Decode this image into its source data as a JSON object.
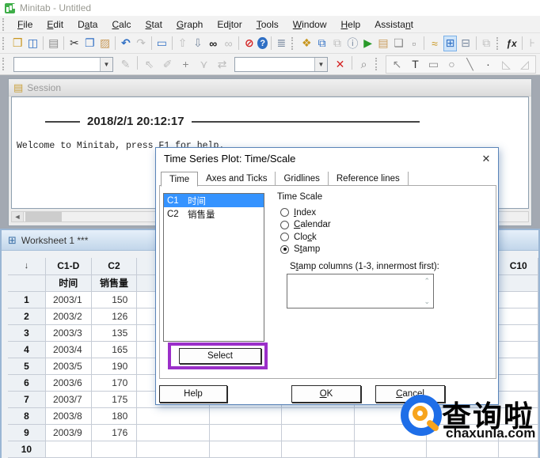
{
  "window": {
    "title": "Minitab - Untitled"
  },
  "menu": {
    "items": [
      {
        "label": "File",
        "accel": 0
      },
      {
        "label": "Edit",
        "accel": 0
      },
      {
        "label": "Data",
        "accel": 1
      },
      {
        "label": "Calc",
        "accel": 0
      },
      {
        "label": "Stat",
        "accel": 0
      },
      {
        "label": "Graph",
        "accel": 0
      },
      {
        "label": "Editor",
        "accel": 2
      },
      {
        "label": "Tools",
        "accel": 0
      },
      {
        "label": "Window",
        "accel": 0
      },
      {
        "label": "Help",
        "accel": 0
      },
      {
        "label": "Assistant",
        "accel": 7
      }
    ]
  },
  "toolbar_main": {
    "icons": [
      {
        "t": "g"
      },
      {
        "t": "i",
        "name": "open-icon",
        "g": "❒",
        "c": "gold"
      },
      {
        "t": "i",
        "name": "save-icon",
        "g": "◫",
        "c": "blue"
      },
      {
        "t": "s"
      },
      {
        "t": "i",
        "name": "print-icon",
        "g": "▤",
        "c": "dim"
      },
      {
        "t": "s"
      },
      {
        "t": "i",
        "name": "cut-icon",
        "g": "✂",
        "c": "dark"
      },
      {
        "t": "i",
        "name": "copy-icon",
        "g": "❐",
        "c": "blue"
      },
      {
        "t": "i",
        "name": "paste-icon",
        "g": "▨",
        "c": "tan"
      },
      {
        "t": "s"
      },
      {
        "t": "i",
        "name": "undo-icon",
        "g": "↶",
        "c": "blueb"
      },
      {
        "t": "i",
        "name": "redo-icon",
        "g": "↷",
        "c": "dis"
      },
      {
        "t": "s"
      },
      {
        "t": "i",
        "name": "edit-last-dialog-icon",
        "g": "▭",
        "c": "blue"
      },
      {
        "t": "s"
      },
      {
        "t": "i",
        "name": "previous-command-icon",
        "g": "⇧",
        "c": "dis"
      },
      {
        "t": "i",
        "name": "next-command-icon",
        "g": "⇩",
        "c": "steel"
      },
      {
        "t": "i",
        "name": "find-icon",
        "g": "∞",
        "c": "darkb"
      },
      {
        "t": "i",
        "name": "find-next-icon",
        "g": "∞",
        "c": "dis"
      },
      {
        "t": "s"
      },
      {
        "t": "i",
        "name": "cancel-icon",
        "g": "⊘",
        "c": "redb"
      },
      {
        "t": "i",
        "name": "help-icon",
        "g": "?",
        "c": "badge"
      },
      {
        "t": "s"
      },
      {
        "t": "i",
        "name": "show-session-icon",
        "g": "≣",
        "c": "steel"
      },
      {
        "t": "g"
      },
      {
        "t": "i",
        "name": "session-window-icon",
        "g": "❖",
        "c": "gold"
      },
      {
        "t": "i",
        "name": "worksheets-icon",
        "g": "⧉",
        "c": "blue"
      },
      {
        "t": "i",
        "name": "copy-worksheet-icon",
        "g": "⧉",
        "c": "dis"
      },
      {
        "t": "i",
        "name": "info-icon",
        "g": "ⓘ",
        "c": "steel"
      },
      {
        "t": "i",
        "name": "run-icon",
        "g": "▶",
        "c": "green"
      },
      {
        "t": "i",
        "name": "notepad-icon",
        "g": "▤",
        "c": "tan"
      },
      {
        "t": "i",
        "name": "page-up-icon",
        "g": "❏",
        "c": "dim"
      },
      {
        "t": "i",
        "name": "selection-frame-icon",
        "g": "▫",
        "c": "dim"
      },
      {
        "t": "s"
      },
      {
        "t": "i",
        "name": "graph-window-icon",
        "g": "≈",
        "c": "gold"
      },
      {
        "t": "i",
        "name": "worksheet-window-icon",
        "g": "⊞",
        "c": "active"
      },
      {
        "t": "i",
        "name": "split-view-icon",
        "g": "⊟",
        "c": "steel"
      },
      {
        "t": "s"
      },
      {
        "t": "i",
        "name": "cascade-windows-icon",
        "g": "⧉",
        "c": "dis"
      },
      {
        "t": "g"
      },
      {
        "t": "i",
        "name": "function-icon",
        "g": "ƒx",
        "c": "darki"
      },
      {
        "t": "s"
      },
      {
        "t": "i",
        "name": "project-tree-icon",
        "g": "⊦",
        "c": "dis"
      }
    ]
  },
  "toolbar_edit": {
    "combo1": "",
    "combo2": "",
    "icons_left": [
      {
        "t": "i",
        "name": "edit-points-icon",
        "g": "✎",
        "c": "dis"
      },
      {
        "t": "s"
      },
      {
        "t": "i",
        "name": "select-item-icon",
        "g": "⇖",
        "c": "dis"
      },
      {
        "t": "i",
        "name": "brush-icon",
        "g": "✐",
        "c": "dis"
      },
      {
        "t": "i",
        "name": "crosshair-icon",
        "g": "+",
        "c": "dim"
      },
      {
        "t": "i",
        "name": "flag-icon",
        "g": "⋎",
        "c": "dis"
      },
      {
        "t": "i",
        "name": "swap-icon",
        "g": "⇄",
        "c": "dis"
      }
    ],
    "icons_mid": [
      {
        "t": "i",
        "name": "delete-icon",
        "g": "✕",
        "c": "redb"
      },
      {
        "t": "s"
      },
      {
        "t": "i",
        "name": "zoom-icon",
        "g": "⌕",
        "c": "dim"
      }
    ],
    "icons_right": [
      {
        "t": "i",
        "name": "select-tool-icon",
        "g": "↖",
        "c": "dim"
      },
      {
        "t": "i",
        "name": "text-tool-icon",
        "g": "T",
        "c": "dark"
      },
      {
        "t": "i",
        "name": "rect-tool-icon",
        "g": "▭",
        "c": "dim"
      },
      {
        "t": "i",
        "name": "ellipse-tool-icon",
        "g": "○",
        "c": "dim"
      },
      {
        "t": "i",
        "name": "line-tool-icon",
        "g": "╲",
        "c": "dim"
      },
      {
        "t": "i",
        "name": "marker-tool-icon",
        "g": "·",
        "c": "dark"
      },
      {
        "t": "i",
        "name": "polygon-tool-icon",
        "g": "◺",
        "c": "dis"
      },
      {
        "t": "i",
        "name": "polyline-tool-icon",
        "g": "◿",
        "c": "dis"
      }
    ]
  },
  "session": {
    "title": "Session",
    "timestamp": "2018/2/1 20:12:17",
    "welcome": "Welcome to Minitab, press F1 for help."
  },
  "dialog": {
    "title": "Time Series Plot: Time/Scale",
    "close": "✕",
    "tabs": [
      {
        "label": "Time"
      },
      {
        "label": "Axes and Ticks"
      },
      {
        "label": "Gridlines"
      },
      {
        "label": "Reference lines"
      }
    ],
    "active_tab": "Time",
    "columns": [
      {
        "id": "C1",
        "name": "时间",
        "selected": true
      },
      {
        "id": "C2",
        "name": "销售量",
        "selected": false
      }
    ],
    "time_scale": {
      "label": "Time Scale",
      "options": [
        {
          "label": "Index",
          "accel": 0
        },
        {
          "label": "Calendar",
          "accel": 0
        },
        {
          "label": "Clock",
          "accel": 3
        },
        {
          "label": "Stamp",
          "accel": 1
        }
      ],
      "selected": "Stamp"
    },
    "stamp": {
      "label": {
        "label": "Stamp columns (1-3, innermost first):",
        "accel": 1
      },
      "value": ""
    },
    "buttons": {
      "select": "Select",
      "help": "Help",
      "ok": {
        "label": "OK",
        "accel": 0
      },
      "cancel": {
        "label": "Cancel",
        "accel": 0
      }
    }
  },
  "worksheet": {
    "title": "Worksheet 1 ***",
    "corner": "↓",
    "col_ids": [
      "C1-D",
      "C2"
    ],
    "col_names": [
      "时间",
      "销售量"
    ],
    "far_col_id": "C10",
    "rows": [
      {
        "n": "1",
        "time": "2003/1",
        "sales": "150"
      },
      {
        "n": "2",
        "time": "2003/2",
        "sales": "126"
      },
      {
        "n": "3",
        "time": "2003/3",
        "sales": "135"
      },
      {
        "n": "4",
        "time": "2003/4",
        "sales": "165"
      },
      {
        "n": "5",
        "time": "2003/5",
        "sales": "190"
      },
      {
        "n": "6",
        "time": "2003/6",
        "sales": "170"
      },
      {
        "n": "7",
        "time": "2003/7",
        "sales": "175"
      },
      {
        "n": "8",
        "time": "2003/8",
        "sales": "180"
      },
      {
        "n": "9",
        "time": "2003/9",
        "sales": "176"
      },
      {
        "n": "10",
        "time": "",
        "sales": ""
      }
    ]
  },
  "watermark": {
    "brand": "查询啦",
    "domain": "chaxunla.com"
  },
  "colors": {
    "accent_purple": "#9b2fc9",
    "selection_blue": "#3593ff",
    "logo_blue": "#1e6ee8",
    "logo_orange": "#f7a41d",
    "minitab_green": "#3fae49"
  }
}
